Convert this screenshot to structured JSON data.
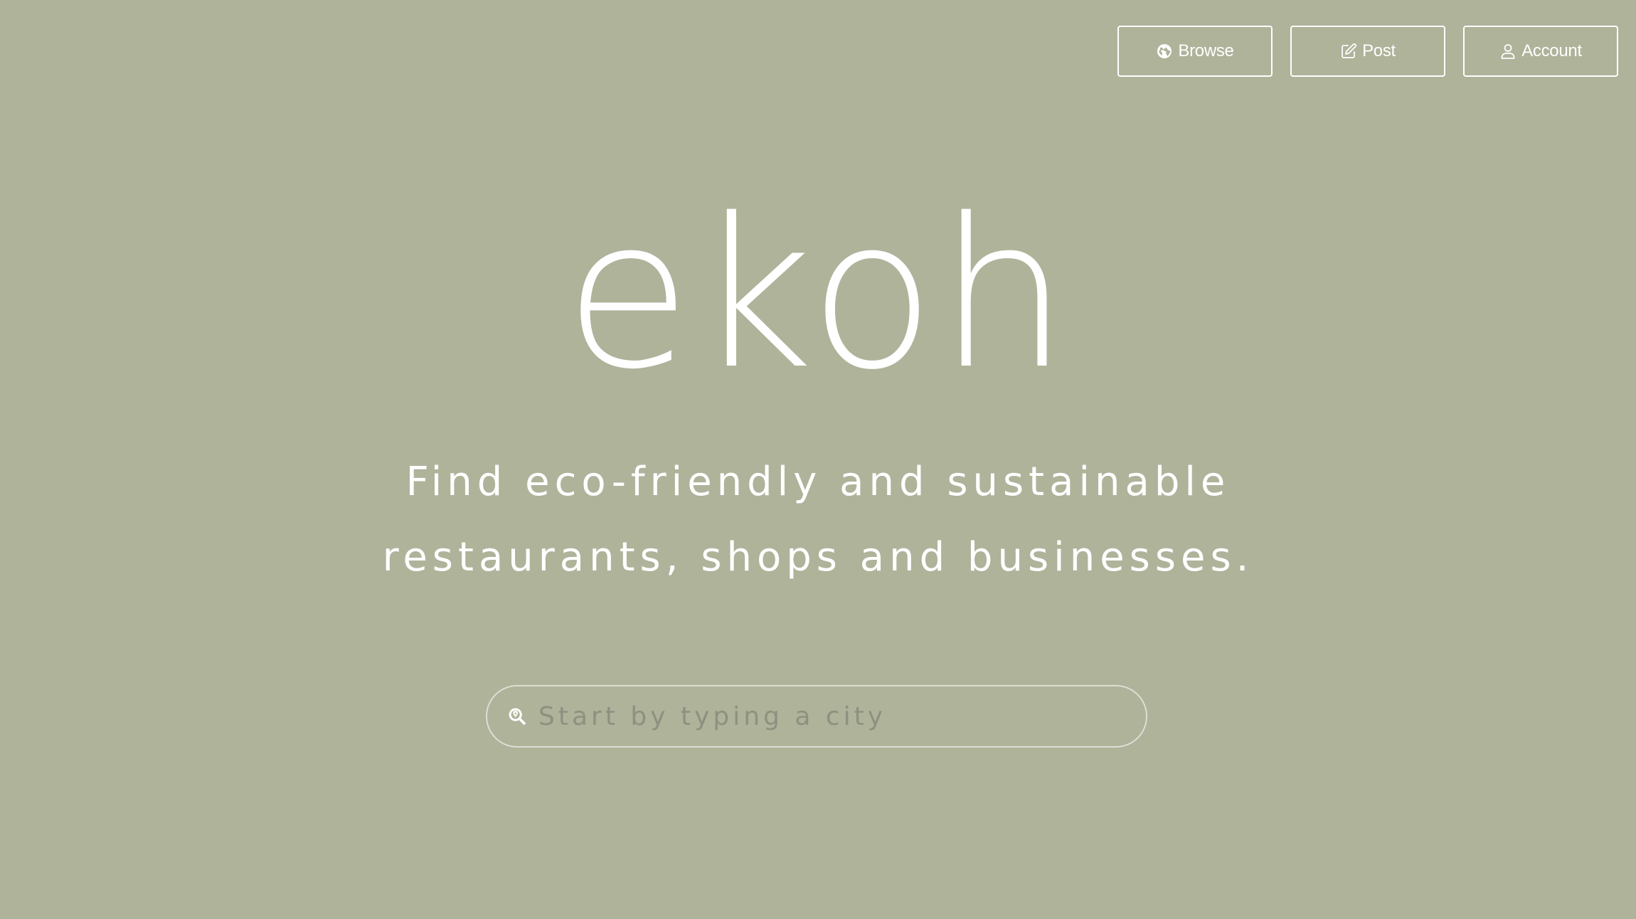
{
  "nav": {
    "browse_label": "Browse",
    "browse_icon": "globe-icon",
    "post_label": "Post",
    "post_icon": "edit-icon",
    "account_label": "Account",
    "account_icon": "user-icon"
  },
  "hero": {
    "logo": "ekoh",
    "tagline_line1": "Find eco-friendly and sustainable",
    "tagline_line2": "restaurants, shops and businesses."
  },
  "search": {
    "placeholder": "Start by typing a city",
    "value": "",
    "icon": "search-location-icon"
  },
  "colors": {
    "background": "#aeb39a",
    "foreground": "#ffffff",
    "placeholder": "#8e9180"
  }
}
